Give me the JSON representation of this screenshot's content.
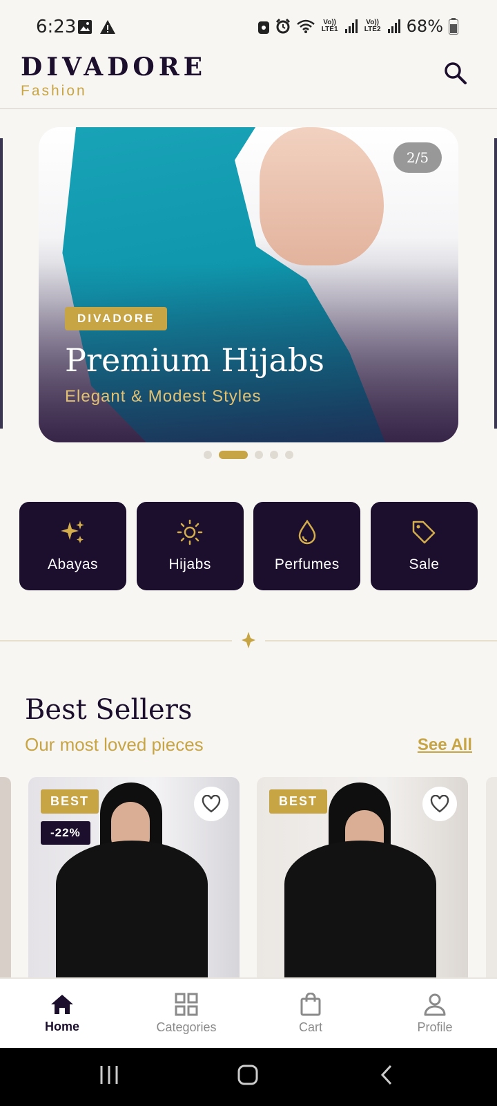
{
  "status": {
    "time": "6:23",
    "sim1": "Vo)) LTE1",
    "sim2": "Vo)) LTE2",
    "battery": "68%"
  },
  "header": {
    "brand": "DIVADORE",
    "subtitle": "Fashion"
  },
  "banner": {
    "counter": "2/5",
    "tag": "DIVADORE",
    "title": "Premium Hijabs",
    "subtitle": "Elegant & Modest Styles",
    "active_slide": 2,
    "total_slides": 5
  },
  "categories": [
    {
      "label": "Abayas",
      "icon": "sparkles-icon"
    },
    {
      "label": "Hijabs",
      "icon": "sun-icon"
    },
    {
      "label": "Perfumes",
      "icon": "drop-icon"
    },
    {
      "label": "Sale",
      "icon": "tag-icon"
    }
  ],
  "best_sellers": {
    "title": "Best Sellers",
    "subtitle": "Our most loved pieces",
    "see_all": "See All",
    "products": [
      {
        "badge": "BEST",
        "discount": "-22%"
      },
      {
        "badge": "BEST"
      }
    ]
  },
  "bottom_nav": [
    {
      "label": "Home",
      "icon": "home-icon",
      "active": true
    },
    {
      "label": "Categories",
      "icon": "grid-icon",
      "active": false
    },
    {
      "label": "Cart",
      "icon": "bag-icon",
      "active": false
    },
    {
      "label": "Profile",
      "icon": "person-icon",
      "active": false
    }
  ],
  "colors": {
    "accent_gold": "#c7a444",
    "brand_dark": "#1c0f2e",
    "background": "#f8f6f2"
  }
}
